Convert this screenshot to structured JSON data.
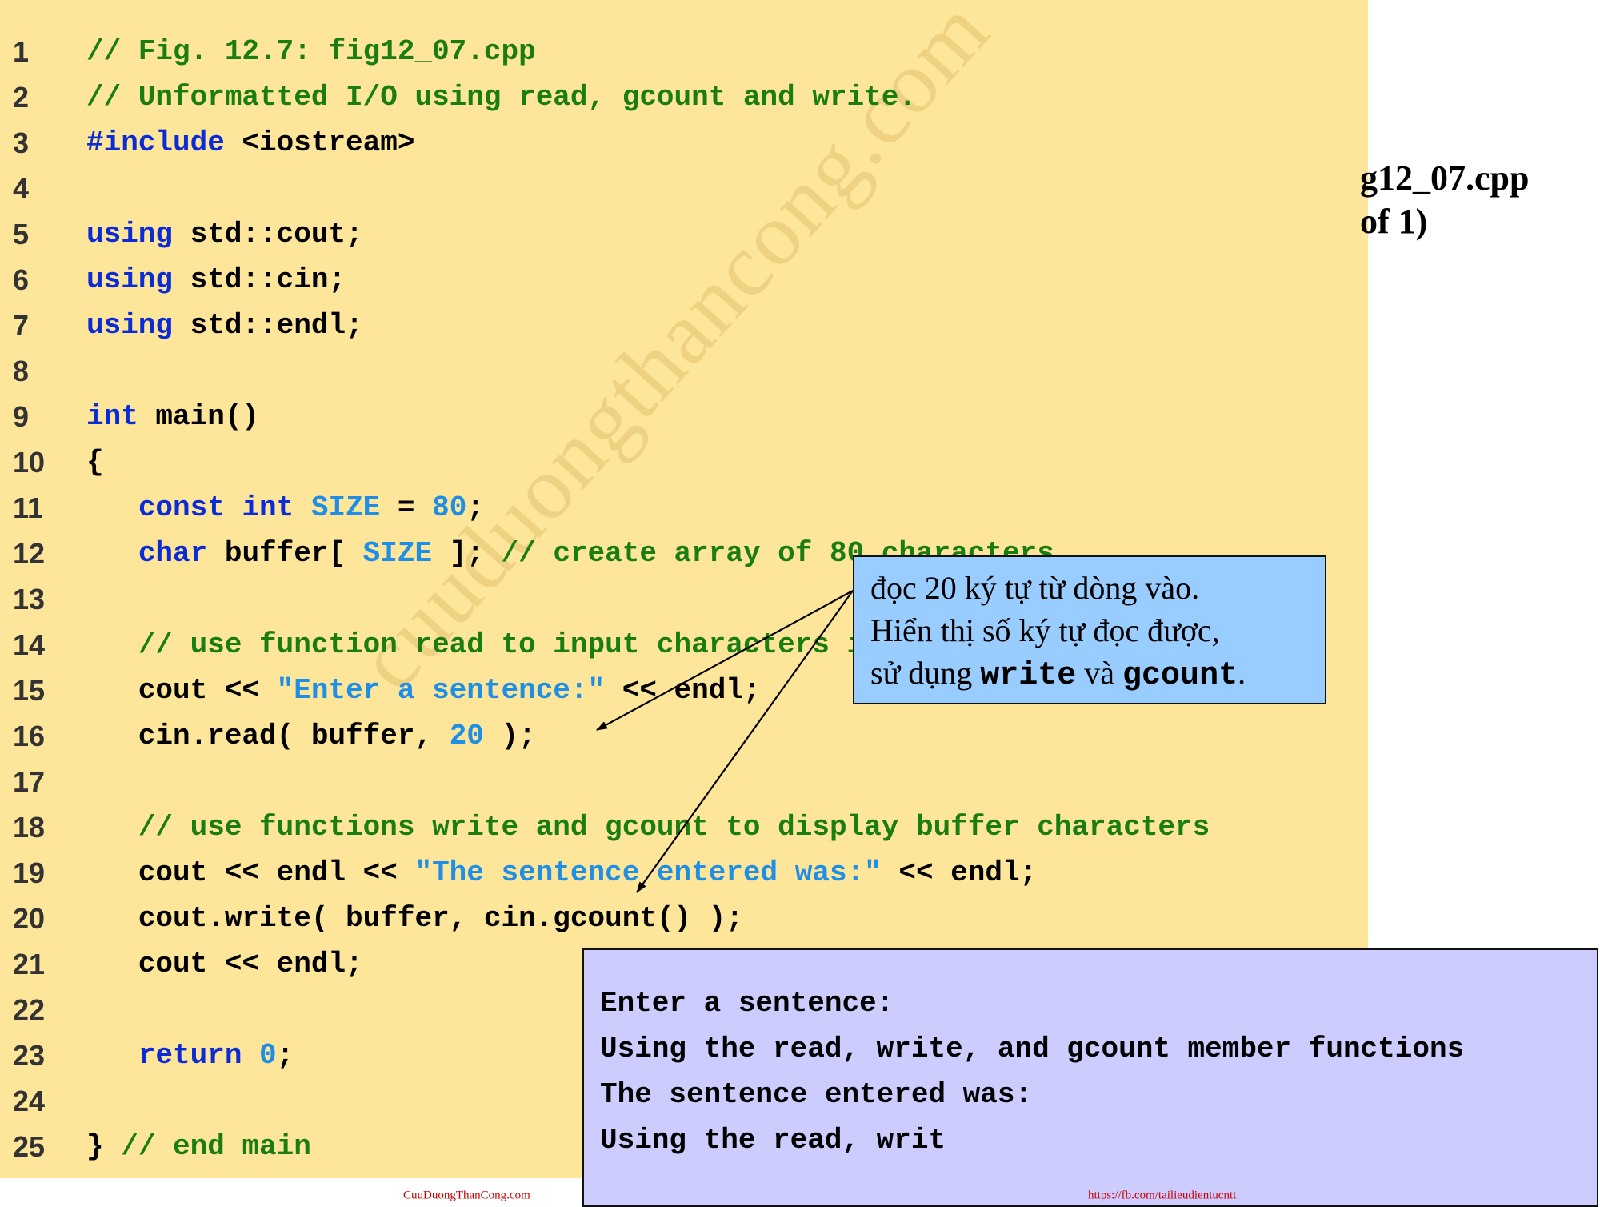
{
  "side_title": {
    "line1": "g12_07.cpp",
    "line2": "of 1)"
  },
  "watermark": "cuuduongthancong.com",
  "code_lines": [
    {
      "n": "1",
      "tokens": [
        {
          "t": "cm",
          "v": "// Fig. 12.7: fig12_07.cpp"
        }
      ]
    },
    {
      "n": "2",
      "tokens": [
        {
          "t": "cm",
          "v": "// Unformatted I/O using read, gcount and write."
        }
      ]
    },
    {
      "n": "3",
      "tokens": [
        {
          "t": "pp",
          "v": "#include"
        },
        {
          "t": "tx",
          "v": " <iostream>"
        }
      ]
    },
    {
      "n": "4",
      "tokens": []
    },
    {
      "n": "5",
      "tokens": [
        {
          "t": "kw",
          "v": "using"
        },
        {
          "t": "tx",
          "v": " std::cout;"
        }
      ]
    },
    {
      "n": "6",
      "tokens": [
        {
          "t": "kw",
          "v": "using"
        },
        {
          "t": "tx",
          "v": " std::cin;"
        }
      ]
    },
    {
      "n": "7",
      "tokens": [
        {
          "t": "kw",
          "v": "using"
        },
        {
          "t": "tx",
          "v": " std::endl;"
        }
      ]
    },
    {
      "n": "8",
      "tokens": []
    },
    {
      "n": "9",
      "tokens": [
        {
          "t": "kw",
          "v": "int"
        },
        {
          "t": "tx",
          "v": " main()"
        }
      ]
    },
    {
      "n": "10",
      "tokens": [
        {
          "t": "tx",
          "v": "{"
        }
      ]
    },
    {
      "n": "11",
      "tokens": [
        {
          "t": "tx",
          "v": "   "
        },
        {
          "t": "kw",
          "v": "const"
        },
        {
          "t": "tx",
          "v": " "
        },
        {
          "t": "kw",
          "v": "int"
        },
        {
          "t": "tx",
          "v": " "
        },
        {
          "t": "nm",
          "v": "SIZE"
        },
        {
          "t": "tx",
          "v": " = "
        },
        {
          "t": "nm",
          "v": "80"
        },
        {
          "t": "tx",
          "v": ";"
        }
      ]
    },
    {
      "n": "12",
      "tokens": [
        {
          "t": "tx",
          "v": "   "
        },
        {
          "t": "kw",
          "v": "char"
        },
        {
          "t": "tx",
          "v": " buffer[ "
        },
        {
          "t": "nm",
          "v": "SIZE"
        },
        {
          "t": "tx",
          "v": " ]; "
        },
        {
          "t": "cm",
          "v": "// create array of 80 characters"
        }
      ]
    },
    {
      "n": "13",
      "tokens": []
    },
    {
      "n": "14",
      "tokens": [
        {
          "t": "tx",
          "v": "   "
        },
        {
          "t": "cm",
          "v": "// use function read to input characters into buffer"
        }
      ]
    },
    {
      "n": "15",
      "tokens": [
        {
          "t": "tx",
          "v": "   cout << "
        },
        {
          "t": "st",
          "v": "\"Enter a sentence:\""
        },
        {
          "t": "tx",
          "v": " << endl;"
        }
      ]
    },
    {
      "n": "16",
      "tokens": [
        {
          "t": "tx",
          "v": "   cin.read( buffer, "
        },
        {
          "t": "nm",
          "v": "20"
        },
        {
          "t": "tx",
          "v": " );"
        }
      ]
    },
    {
      "n": "17",
      "tokens": []
    },
    {
      "n": "18",
      "tokens": [
        {
          "t": "tx",
          "v": "   "
        },
        {
          "t": "cm",
          "v": "// use functions write and gcount to display buffer characters"
        }
      ]
    },
    {
      "n": "19",
      "tokens": [
        {
          "t": "tx",
          "v": "   cout << endl << "
        },
        {
          "t": "st",
          "v": "\"The sentence entered was:\""
        },
        {
          "t": "tx",
          "v": " << endl;"
        }
      ]
    },
    {
      "n": "20",
      "tokens": [
        {
          "t": "tx",
          "v": "   cout.write( buffer, cin.gcount() );"
        }
      ]
    },
    {
      "n": "21",
      "tokens": [
        {
          "t": "tx",
          "v": "   cout << endl;"
        }
      ]
    },
    {
      "n": "22",
      "tokens": []
    },
    {
      "n": "23",
      "tokens": [
        {
          "t": "tx",
          "v": "   "
        },
        {
          "t": "kw",
          "v": "return"
        },
        {
          "t": "tx",
          "v": " "
        },
        {
          "t": "nm",
          "v": "0"
        },
        {
          "t": "tx",
          "v": ";"
        }
      ]
    },
    {
      "n": "24",
      "tokens": []
    },
    {
      "n": "25",
      "tokens": [
        {
          "t": "tx",
          "v": "} "
        },
        {
          "t": "cm",
          "v": "// end main"
        }
      ]
    }
  ],
  "callout": {
    "line1": "đọc 20 ký tự từ dòng vào.",
    "line2": "Hiển thị số ký tự đọc được,",
    "line3_prefix": "sử dụng ",
    "line3_code1": "write",
    "line3_mid": " và ",
    "line3_code2": "gcount",
    "line3_suffix": "."
  },
  "output_lines": [
    "Enter a sentence:",
    "Using the read, write, and gcount member functions",
    "The sentence entered was:",
    "Using the read, writ"
  ],
  "footer": {
    "left": "CuuDuongThanCong.com",
    "right": "https://fb.com/tailieudientucntt"
  },
  "colors": {
    "panel": "#fde59a",
    "keyword": "#0b2bd6",
    "comment": "#1a7d12",
    "string_number": "#1f8fe6",
    "callout_bg": "#99ccff",
    "output_bg": "#ccccff",
    "footer_text": "#cc0000"
  }
}
